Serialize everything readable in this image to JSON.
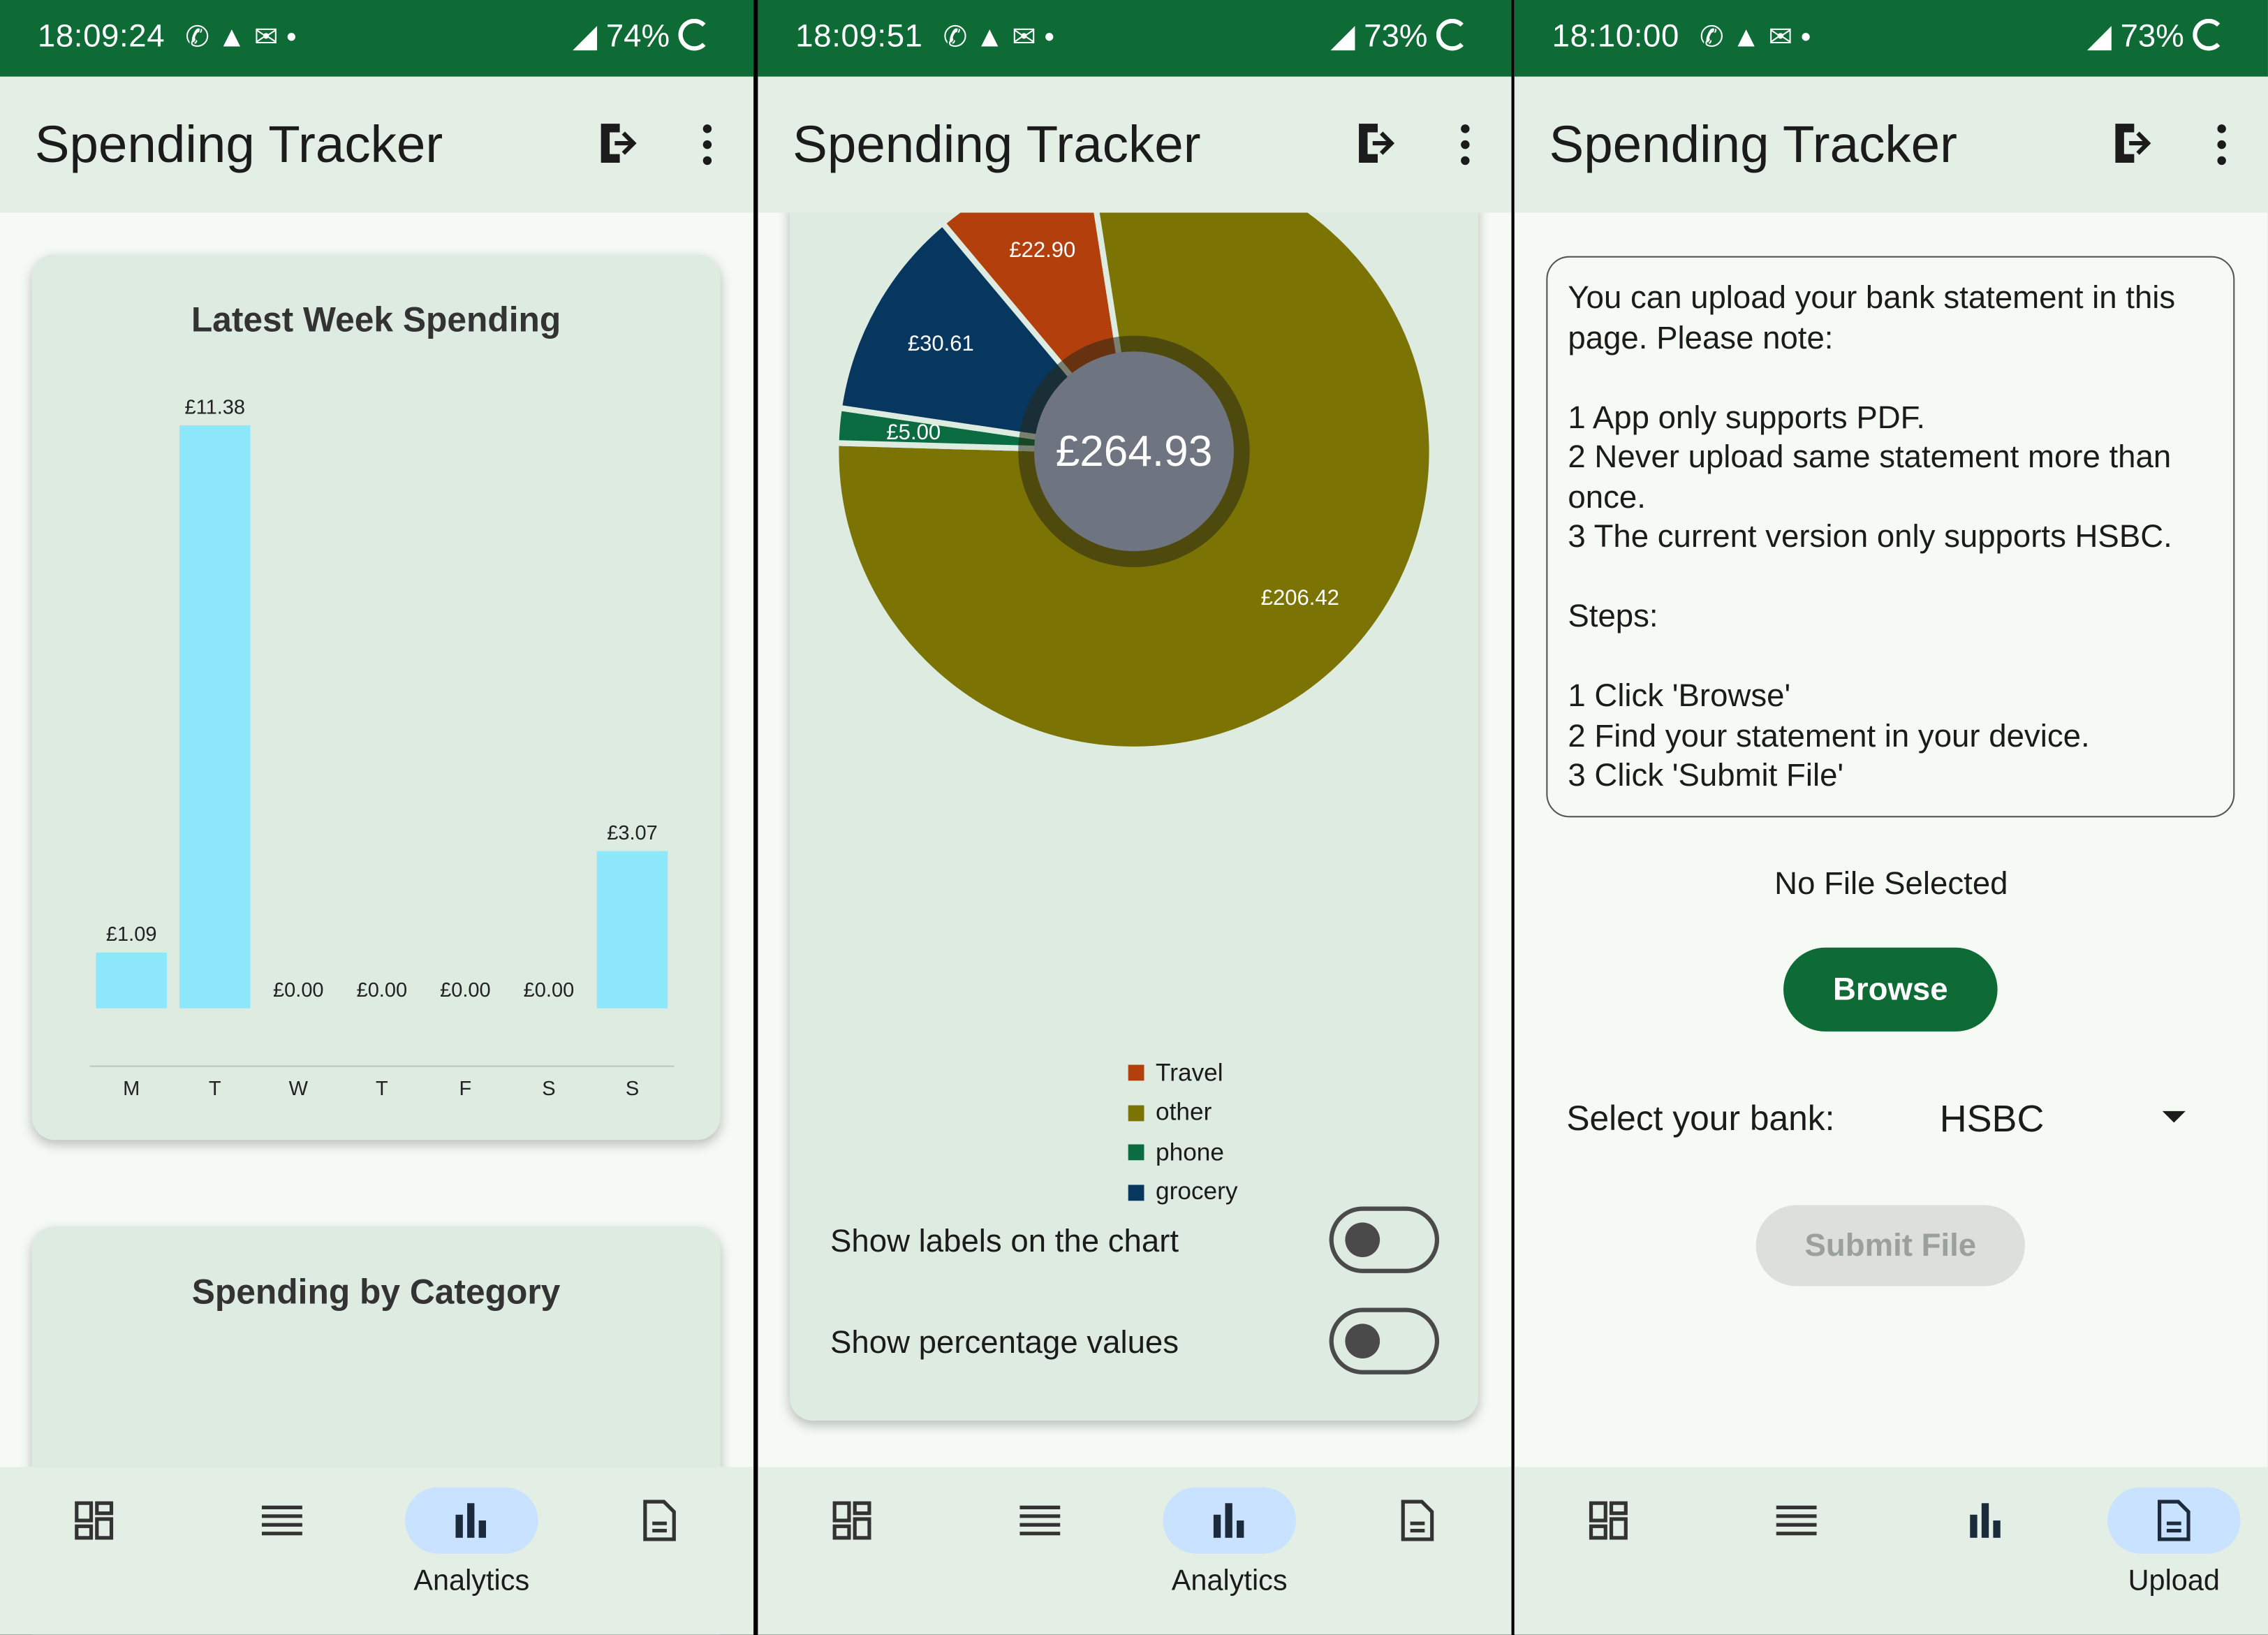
{
  "screens": [
    {
      "status": {
        "time": "18:09:24",
        "battery": "74%"
      },
      "appbar": {
        "title": "Spending Tracker"
      },
      "card1": {
        "title": "Latest Week Spending"
      },
      "card2": {
        "title": "Spending by Category"
      },
      "nav": {
        "active_label": "Analytics"
      }
    },
    {
      "status": {
        "time": "18:09:51",
        "battery": "73%"
      },
      "appbar": {
        "title": "Spending Tracker"
      },
      "toggles": {
        "labels": "Show labels on the chart",
        "percent": "Show percentage values"
      },
      "nav": {
        "active_label": "Analytics"
      }
    },
    {
      "status": {
        "time": "18:10:00",
        "battery": "73%"
      },
      "appbar": {
        "title": "Spending Tracker"
      },
      "info": {
        "line1": "You can upload your bank statement in this page. Please note:",
        "line2": "1 App only supports PDF.",
        "line3": "2 Never upload same statement more than once.",
        "line4": "3 The current version only supports HSBC.",
        "line5": "Steps:",
        "line6": "1 Click 'Browse'",
        "line7": "2 Find your statement in your device.",
        "line8": "3 Click 'Submit File'"
      },
      "file_status": "No File Selected",
      "browse_label": "Browse",
      "bank_label": "Select your bank:",
      "bank_value": "HSBC",
      "submit_label": "Submit File",
      "nav": {
        "active_label": "Upload"
      }
    }
  ],
  "chart_data": [
    {
      "type": "bar",
      "title": "Latest Week Spending",
      "categories": [
        "M",
        "T",
        "W",
        "T",
        "F",
        "S",
        "S"
      ],
      "values": [
        1.09,
        11.38,
        0.0,
        0.0,
        0.0,
        0.0,
        3.07
      ],
      "value_labels": [
        "£1.09",
        "£11.38",
        "£0.00",
        "£0.00",
        "£0.00",
        "£0.00",
        "£3.07"
      ],
      "color": "#8ee8fb"
    },
    {
      "type": "pie",
      "center_label": "£264.93",
      "slices": [
        {
          "name": "Travel",
          "value": 22.9,
          "label": "£22.90",
          "color": "#b33f0c"
        },
        {
          "name": "other",
          "value": 206.42,
          "label": "£206.42",
          "color": "#7c7305"
        },
        {
          "name": "phone",
          "value": 5.0,
          "label": "£5.00",
          "color": "#0b6b41"
        },
        {
          "name": "grocery",
          "value": 30.61,
          "label": "£30.61",
          "color": "#07375f"
        }
      ],
      "legend": [
        "Travel",
        "other",
        "phone",
        "grocery"
      ]
    }
  ]
}
